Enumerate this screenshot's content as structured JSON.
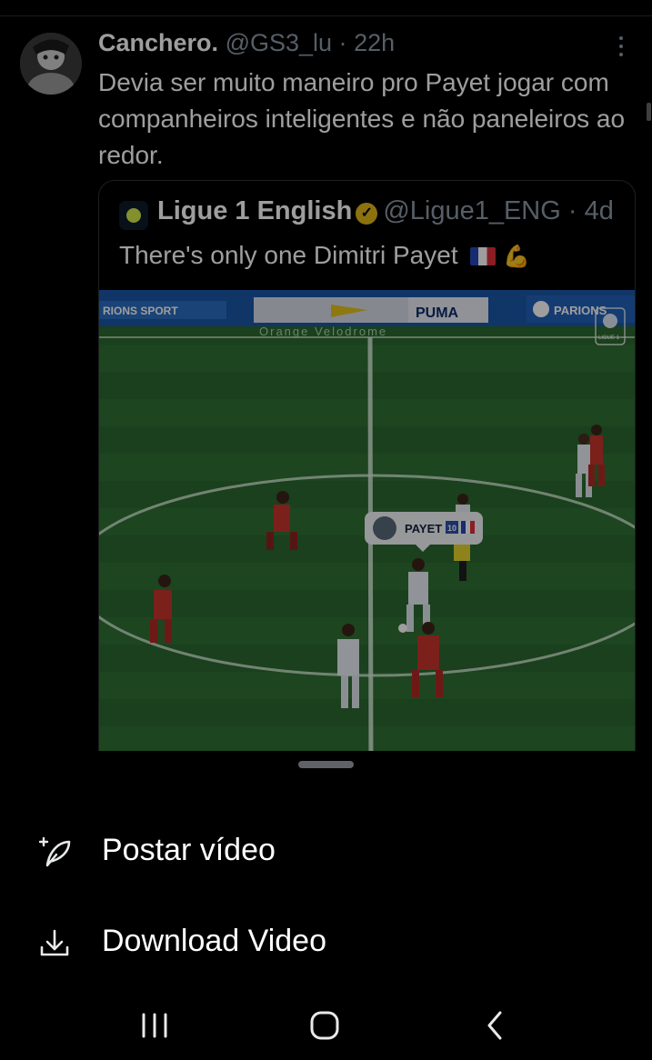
{
  "tweet": {
    "author": "Canchero.",
    "handle": "@GS3_lu",
    "separator": "·",
    "time": "22h",
    "text": "Devia ser muito maneiro pro Payet jogar com companheiros inteligentes e não paneleiros ao redor.",
    "avatar_icon": "avatar-photo",
    "more_icon": "more-vertical-icon"
  },
  "quote": {
    "author": "Ligue 1 English",
    "verified_icon": "verified-gold-badge",
    "handle": "@Ligue1_ENG",
    "separator": "·",
    "time": "4d",
    "text": "There's only one Dimitri Payet",
    "emoji": [
      "french-flag",
      "flexed-biceps"
    ],
    "video": {
      "ad_left": "RIONS SPORT",
      "ad_puma": "PUMA",
      "ad_parions": "PARIONS",
      "stadium": "Orange Velodrome",
      "player_tag": "PAYET",
      "player_number": "10",
      "corner_logo": "LIGUE 1"
    }
  },
  "sheet": {
    "items": [
      {
        "label": "Postar vídeo",
        "icon": "compose-feather-icon"
      },
      {
        "label": "Download Video",
        "icon": "download-icon"
      }
    ]
  },
  "colors": {
    "background": "#000000",
    "text": "#ffffff",
    "secondary": "#8b98a5",
    "pitch": "#2e6e33",
    "verified": "#e2b719"
  },
  "navbar": {
    "icons": [
      "recent-apps-icon",
      "home-icon",
      "back-icon"
    ]
  }
}
